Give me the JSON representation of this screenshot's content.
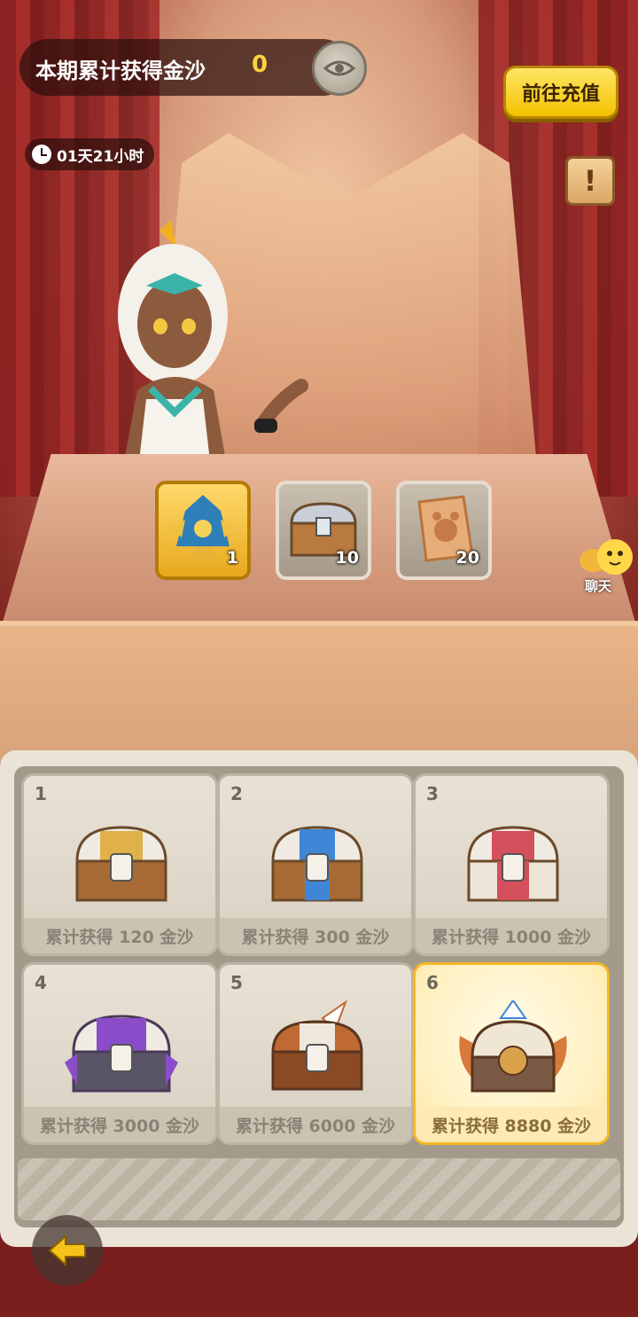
{
  "header": {
    "title": "本期累计获得金沙",
    "count": "0",
    "recharge_label": "前往充值",
    "timer": "01天21小时"
  },
  "rewards": [
    {
      "qty": "1",
      "icon": "helmet-icon"
    },
    {
      "qty": "10",
      "icon": "chest-icon"
    },
    {
      "qty": "20",
      "icon": "scroll-icon"
    }
  ],
  "chat": {
    "label": "聊天"
  },
  "milestones": [
    {
      "num": "1",
      "caption": "累计获得 120 金沙",
      "color": "#e0b04a"
    },
    {
      "num": "2",
      "caption": "累计获得 300 金沙",
      "color": "#3f86d6"
    },
    {
      "num": "3",
      "caption": "累计获得 1000 金沙",
      "color": "#d4505c"
    },
    {
      "num": "4",
      "caption": "累计获得 3000 金沙",
      "color": "#8a4cc9"
    },
    {
      "num": "5",
      "caption": "累计获得 6000 金沙",
      "color": "#c06a33"
    },
    {
      "num": "6",
      "caption": "累计获得 8880 金沙",
      "color": "#d9a24a"
    }
  ]
}
